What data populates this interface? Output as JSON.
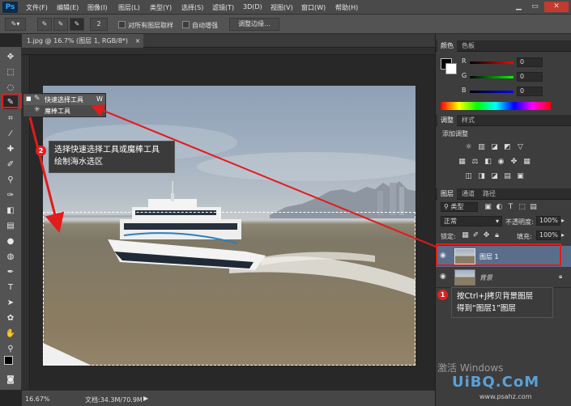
{
  "app": {
    "logo": "Ps"
  },
  "menu": {
    "items": [
      "文件(F)",
      "编辑(E)",
      "图像(I)",
      "图层(L)",
      "类型(Y)",
      "选择(S)",
      "滤镜(T)",
      "3D(D)",
      "视图(V)",
      "窗口(W)",
      "帮助(H)"
    ],
    "window_buttons": [
      "▁",
      "▭",
      "✕"
    ]
  },
  "options": {
    "brush_size": "2",
    "sample_all_layers": "对所有图层取样",
    "auto_enhance": "自动增强",
    "refine_edge": "调整边缘..."
  },
  "document": {
    "tab_title": "1.jpg @ 16.7% (图层 1, RGB/8*)",
    "tab_close": "×",
    "zoom": "16.67%",
    "doc_size": "文档:34.3M/70.9M"
  },
  "tool_flyout": {
    "items": [
      {
        "label": "快速选择工具",
        "shortcut": "W"
      },
      {
        "label": "魔棒工具",
        "shortcut": "W"
      }
    ]
  },
  "panels": {
    "color": {
      "tabs": [
        "颜色",
        "色板"
      ],
      "channels": [
        {
          "label": "R",
          "value": "0"
        },
        {
          "label": "G",
          "value": "0"
        },
        {
          "label": "B",
          "value": "0"
        }
      ]
    },
    "adjustments": {
      "tabs": [
        "调整",
        "样式"
      ],
      "title": "添加调整"
    },
    "layers": {
      "tabs": [
        "图层",
        "通道",
        "路径"
      ],
      "filter": "类型",
      "blend_mode": "正常",
      "opacity_label": "不透明度:",
      "opacity": "100%",
      "lock_label": "锁定:",
      "fill_label": "填充:",
      "fill": "100%",
      "rows": [
        {
          "name": "图层 1",
          "selected": true
        },
        {
          "name": "背景",
          "selected": false
        }
      ]
    }
  },
  "annotations": {
    "step2": {
      "badge": "2",
      "line1": "选择快速选择工具或魔棒工具",
      "line2": "绘制海水选区"
    },
    "step1": {
      "badge": "1",
      "line1": "按Ctrl+J拷贝背景图层",
      "line2": "得到“图层1”图层"
    }
  },
  "watermark": {
    "activate": "激活 Windows",
    "logo": "UiBQ.CoM",
    "url": "www.psahz.com"
  },
  "colors": {
    "accent_red": "#e21b1b",
    "selected_layer": "#5a6e8c"
  }
}
